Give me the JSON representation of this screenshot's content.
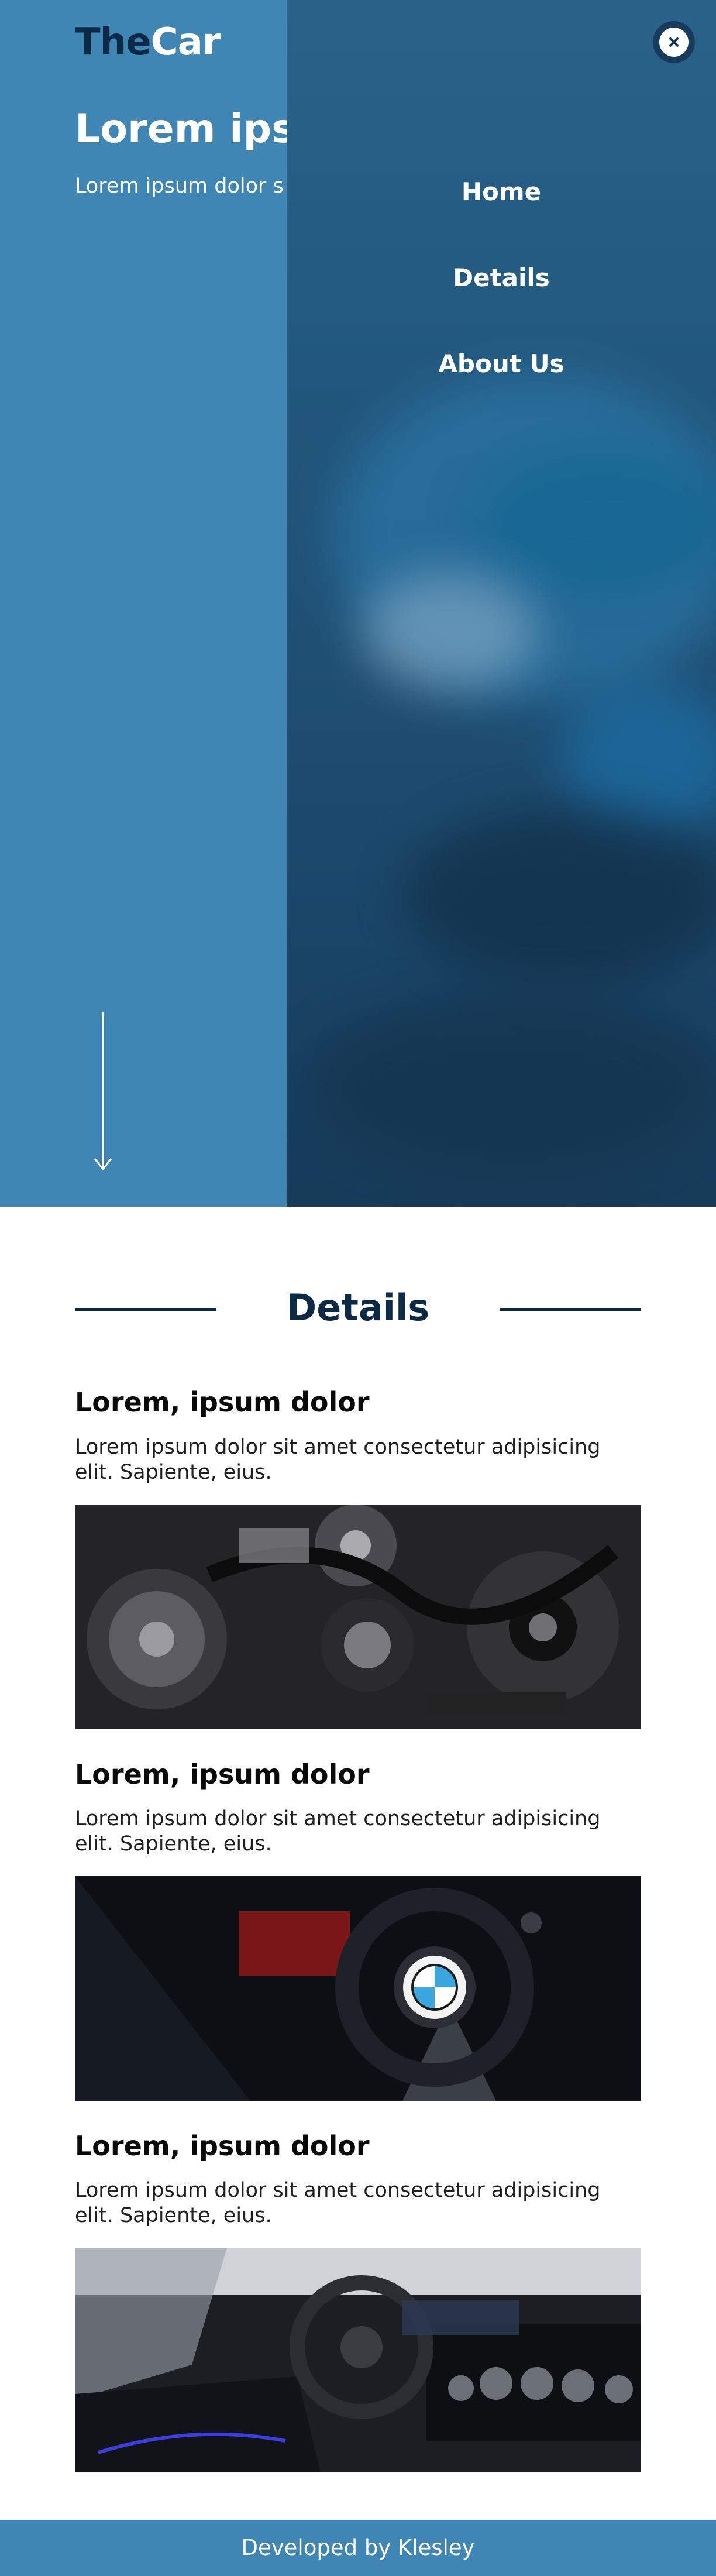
{
  "header": {
    "logo_the": "The",
    "logo_car": "Car"
  },
  "hero": {
    "title": "Lorem ipsu",
    "text": "Lorem ipsum dolor s elit. Maxime, explicab"
  },
  "menu": {
    "items": [
      {
        "label": "Home"
      },
      {
        "label": "Details"
      },
      {
        "label": "About Us"
      }
    ],
    "close_icon": "close-icon"
  },
  "details": {
    "title": "Details",
    "cards": [
      {
        "title": "Lorem, ipsum dolor",
        "text": "Lorem ipsum dolor sit amet consectetur adipisicing elit. Sapiente, eius.",
        "image": "engine"
      },
      {
        "title": "Lorem, ipsum dolor",
        "text": "Lorem ipsum dolor sit amet consectetur adipisicing elit. Sapiente, eius.",
        "image": "bmw-wheel"
      },
      {
        "title": "Lorem, ipsum dolor",
        "text": "Lorem ipsum dolor sit amet consectetur adipisicing elit. Sapiente, eius.",
        "image": "car-interior"
      }
    ]
  },
  "footer": {
    "text": "Developed by Klesley"
  },
  "colors": {
    "primary": "#3f86b4",
    "dark": "#0c2a45",
    "menu_overlay": "#1f4f73"
  }
}
